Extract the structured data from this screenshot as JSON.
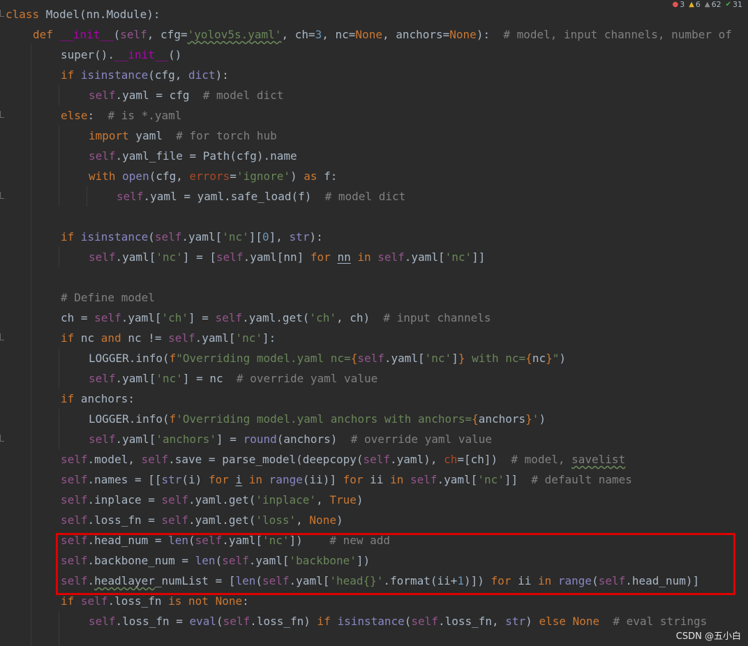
{
  "inspections": {
    "errors": "3",
    "warnings": "6",
    "weak_warnings": "62",
    "typos": "31"
  },
  "code": {
    "l1": {
      "kw": "class",
      "rest": " Model(nn.Module):"
    },
    "l2": {
      "kw": "def",
      "name": " __init__",
      "a": "(",
      "self": "self",
      "b": ", cfg=",
      "str": "'yolov5s.yaml'",
      "c": ", ch=",
      "num": "3",
      "d": ", nc=",
      "none1": "None",
      "e": ", anchors=",
      "none2": "None",
      "f": "):",
      "cmt": "  # model, input channels, number of"
    },
    "l3": {
      "a": "super().",
      "dunder": "__init__",
      "b": "()"
    },
    "l4": {
      "kw": "if",
      "builtin": " isinstance",
      "a": "(cfg, ",
      "dict": "dict",
      "b": "):"
    },
    "l5": {
      "self": "self",
      "a": ".yaml = cfg",
      "cmt": "  # model dict"
    },
    "l6": {
      "kw": "else",
      "a": ":",
      "cmt": "  # is *.yaml"
    },
    "l7": {
      "kw": "import",
      "a": " yaml",
      "cmt": "  # for torch hub"
    },
    "l8": {
      "self": "self",
      "a": ".yaml_file = Path(cfg).name"
    },
    "l9": {
      "kw": "with",
      "builtin": " open",
      "a": "(cfg, ",
      "param": "errors",
      "b": "=",
      "str": "'ignore'",
      "c": ") ",
      "kw2": "as",
      "d": " f:"
    },
    "l10": {
      "self": "self",
      "a": ".yaml = yaml.safe_load(f)",
      "cmt": "  # model dict"
    },
    "l11": {
      "kw": "if",
      "builtin": " isinstance",
      "a": "(",
      "self": "self",
      "b": ".yaml[",
      "str": "'nc'",
      "c": "][",
      "num": "0",
      "d": "], ",
      "builtin2": "str",
      "e": "):"
    },
    "l12": {
      "self": "self",
      "a": ".yaml[",
      "str": "'nc'",
      "b": "] = [",
      "self2": "self",
      "c": ".yaml[nn] ",
      "kw": "for",
      "d": " ",
      "nn": "nn",
      "e": " ",
      "kw2": "in",
      "f": " ",
      "self3": "self",
      "g": ".yaml[",
      "str2": "'nc'",
      "h": "]]"
    },
    "l13": {
      "cmt": "# Define model"
    },
    "l14": {
      "a": "ch = ",
      "self": "self",
      "b": ".yaml[",
      "str": "'ch'",
      "c": "] = ",
      "self2": "self",
      "d": ".yaml.get(",
      "str2": "'ch'",
      "e": ", ch)",
      "cmt": "  # input channels"
    },
    "l15": {
      "kw": "if",
      "a": " nc ",
      "kw2": "and",
      "b": " nc != ",
      "self": "self",
      "c": ".yaml[",
      "str": "'nc'",
      "d": "]:"
    },
    "l16": {
      "a": "LOGGER.info(",
      "fpre": "f",
      "str": "\"Overriding model.yaml nc=",
      "br1": "{",
      "self": "self",
      "b": ".yaml[",
      "str2": "'nc'",
      "c": "]",
      "br2": "}",
      "str3": " with nc=",
      "br3": "{",
      "d": "nc",
      "br4": "}",
      "str4": "\"",
      "e": ")"
    },
    "l17": {
      "self": "self",
      "a": ".yaml[",
      "str": "'nc'",
      "b": "] = nc",
      "cmt": "  # override yaml value"
    },
    "l18": {
      "kw": "if",
      "a": " anchors:"
    },
    "l19": {
      "a": "LOGGER.info(",
      "fpre": "f",
      "str": "'Overriding model.yaml anchors with anchors=",
      "br1": "{",
      "b": "anchors",
      "br2": "}",
      "str2": "'",
      "c": ")"
    },
    "l20": {
      "self": "self",
      "a": ".yaml[",
      "str": "'anchors'",
      "b": "] = ",
      "builtin": "round",
      "c": "(anchors)",
      "cmt": "  # override yaml value"
    },
    "l21": {
      "self": "self",
      "a": ".model, ",
      "self2": "self",
      "b": ".save = parse_model(deepcopy(",
      "self3": "self",
      "c": ".yaml), ",
      "param": "ch",
      "d": "=[ch])",
      "cmt1": "  # model, ",
      "cmt2": "savelist"
    },
    "l22": {
      "self": "self",
      "a": ".names = [[",
      "builtin": "str",
      "b": "(i) ",
      "kw": "for",
      "c": " ",
      "i": "i",
      "d": " ",
      "kw2": "in",
      "e": " ",
      "builtin2": "range",
      "f": "(ii)] ",
      "kw3": "for",
      "g": " ii ",
      "kw4": "in",
      "h": " ",
      "self2": "self",
      "j": ".yaml[",
      "str": "'nc'",
      "k": "]]",
      "cmt": "  # default names"
    },
    "l23": {
      "self": "self",
      "a": ".inplace = ",
      "self2": "self",
      "b": ".yaml.get(",
      "str": "'inplace'",
      "c": ", ",
      "kw": "True",
      "d": ")"
    },
    "l24": {
      "self": "self",
      "a": ".loss_fn = ",
      "self2": "self",
      "b": ".yaml.get(",
      "str": "'loss'",
      "c": ", ",
      "kw": "None",
      "d": ")"
    },
    "l25": {
      "self": "self",
      "a": ".head_num = ",
      "builtin": "len",
      "b": "(",
      "self2": "self",
      "c": ".yaml[",
      "str": "'nc'",
      "d": "])",
      "cmt": "    # new add"
    },
    "l26": {
      "self": "self",
      "a": ".backbone_num = ",
      "builtin": "len",
      "b": "(",
      "self2": "self",
      "c": ".yaml[",
      "str": "'backbone'",
      "d": "])"
    },
    "l27": {
      "self": "self",
      "a": ".",
      "name": "headlayer",
      "b": "_numList = [",
      "builtin": "len",
      "c": "(",
      "self2": "self",
      "d": ".yaml[",
      "str": "'head{}'",
      "e": ".format(ii+",
      "num": "1",
      "f": ")]) ",
      "kw": "for",
      "g": " ii ",
      "kw2": "in",
      "h": " ",
      "builtin2": "range",
      "j": "(",
      "self3": "self",
      "k": ".head_num)]"
    },
    "l28": {
      "kw": "if",
      "a": " ",
      "self": "self",
      "b": ".loss_fn ",
      "kw2": "is not",
      "c": " ",
      "kw3": "None",
      "d": ":"
    },
    "l29": {
      "self": "self",
      "a": ".loss_fn = ",
      "builtin": "eval",
      "b": "(",
      "self2": "self",
      "c": ".loss_fn) ",
      "kw": "if",
      "d": " ",
      "builtin2": "isinstance",
      "e": "(",
      "self3": "self",
      "f": ".loss_fn, ",
      "builtin3": "str",
      "g": ") ",
      "kw2": "else",
      "h": " ",
      "kw3": "None",
      "cmt": "  # eval strings"
    }
  },
  "watermark": "CSDN @五小白",
  "colors": {
    "background": "#2b2b2b",
    "keyword": "#cc7832",
    "self": "#94558d",
    "string": "#6a8759",
    "comment": "#808080",
    "highlight": "#e00000"
  }
}
